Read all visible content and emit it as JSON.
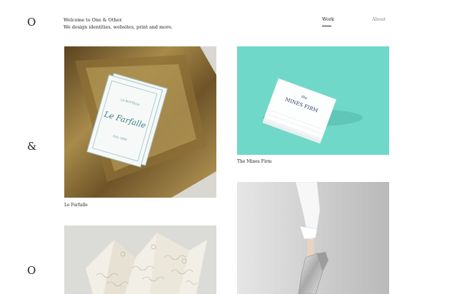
{
  "sidebar": {
    "mark_top": "O",
    "mark_middle": "&",
    "mark_bottom": "O"
  },
  "header": {
    "intro_line1": "Welcome to One & Other.",
    "intro_line2": "We design identities, websites, print and more.",
    "nav": [
      {
        "label": "Work",
        "active": true
      },
      {
        "label": "About",
        "active": false
      }
    ]
  },
  "projects": [
    {
      "title": "Le Farfalle",
      "card_text_small": "LA BOTTEGA",
      "card_text_script": "Le Farfalle",
      "card_text_lower": "DAL 1899"
    },
    {
      "title": "The Mines Firm",
      "card_text_small": "the",
      "card_text_main": "MINES FIRM"
    },
    {
      "title": "",
      "image": "folded-patterned-paper"
    },
    {
      "title": "",
      "image": "silver-shoes"
    }
  ],
  "colors": {
    "teal_background": "#6fd8c9",
    "gold": "#9a7a3c",
    "nav_active": "#222222",
    "nav_inactive": "#888888"
  }
}
